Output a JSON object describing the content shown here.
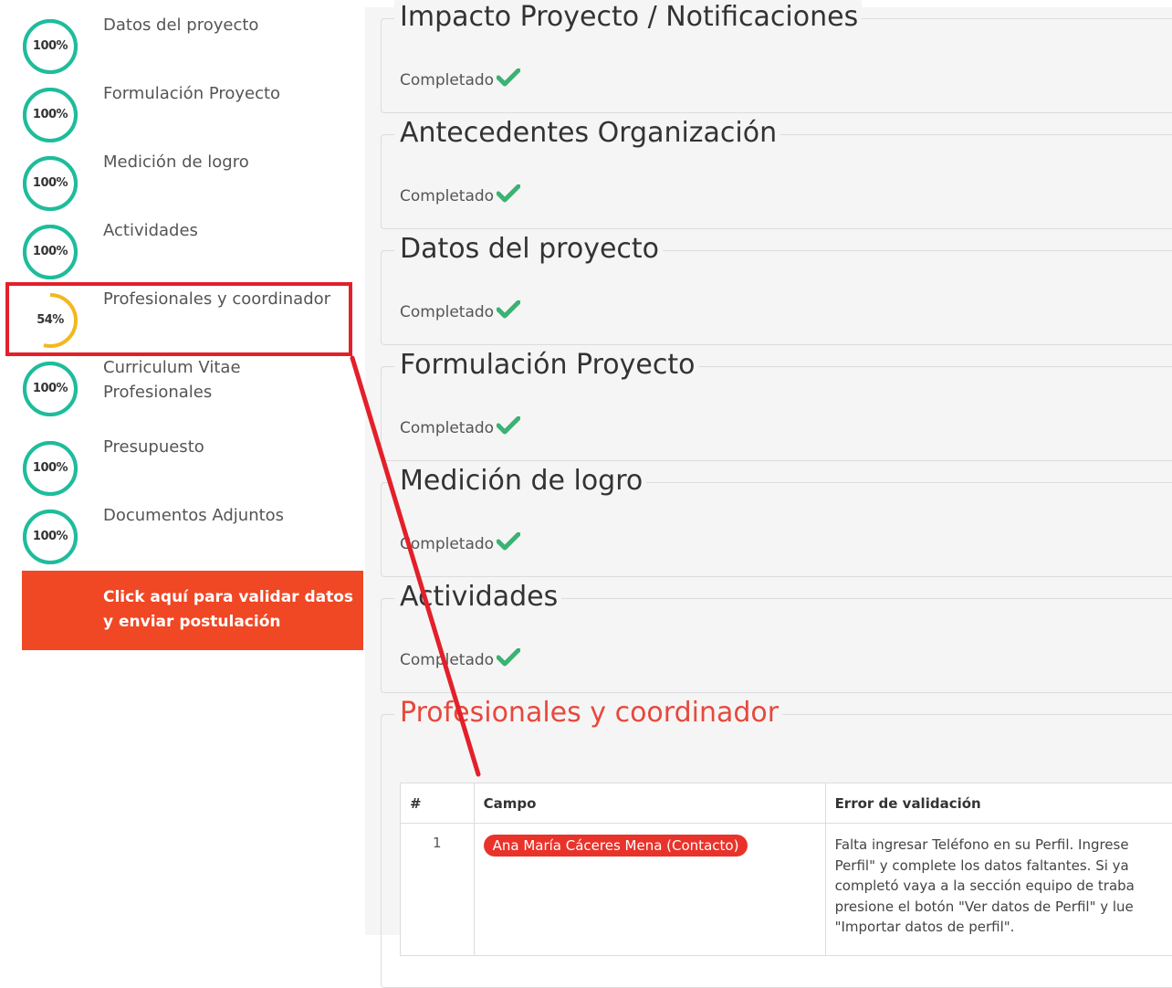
{
  "sidebar": {
    "steps": [
      {
        "label": "Datos del proyecto",
        "pct": "100%",
        "value": 100,
        "color": "#1ebc9c"
      },
      {
        "label": "Formulación Proyecto",
        "pct": "100%",
        "value": 100,
        "color": "#1ebc9c"
      },
      {
        "label": "Medición de logro",
        "pct": "100%",
        "value": 100,
        "color": "#1ebc9c"
      },
      {
        "label": "Actividades",
        "pct": "100%",
        "value": 100,
        "color": "#1ebc9c"
      },
      {
        "label": "Profesionales y coordinador",
        "pct": "54%",
        "value": 54,
        "color": "#f4b71c"
      },
      {
        "label": "Curriculum Vitae Profesionales",
        "pct": "100%",
        "value": 100,
        "color": "#1ebc9c"
      },
      {
        "label": "Presupuesto",
        "pct": "100%",
        "value": 100,
        "color": "#1ebc9c"
      },
      {
        "label": "Documentos Adjuntos",
        "pct": "100%",
        "value": 100,
        "color": "#1ebc9c"
      }
    ],
    "validate_button": "Click aquí para validar datos y enviar postulación",
    "highlight_color": "#e3202a"
  },
  "main": {
    "sections": [
      {
        "title": "Impacto Proyecto / Notificaciones",
        "status": "Completado"
      },
      {
        "title": "Antecedentes Organización",
        "status": "Completado"
      },
      {
        "title": "Datos del proyecto",
        "status": "Completado"
      },
      {
        "title": "Formulación Proyecto",
        "status": "Completado"
      },
      {
        "title": "Medición de logro",
        "status": "Completado"
      },
      {
        "title": "Actividades",
        "status": "Completado"
      }
    ],
    "open_section": {
      "title": "Profesionales y coordinador",
      "table": {
        "headers": [
          "#",
          "Campo",
          "Error de validación"
        ],
        "rows": [
          {
            "num": "1",
            "campo": "Ana María Cáceres Mena (Contacto)",
            "error_lines": [
              "Falta ingresar Teléfono en su Perfil. Ingrese",
              "Perfil\" y complete los datos faltantes. Si ya",
              "completó vaya a la sección equipo de traba",
              "presione el botón \"Ver datos de Perfil\" y lue",
              "\"Importar datos de perfil\"."
            ]
          }
        ]
      }
    },
    "check_color": "#3bb273"
  }
}
